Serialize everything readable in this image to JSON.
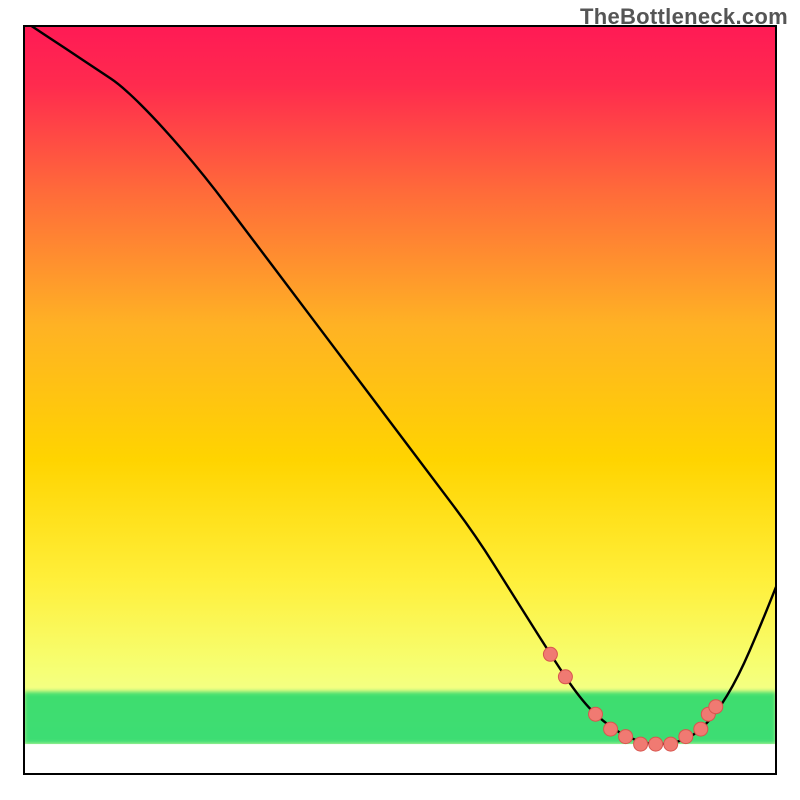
{
  "watermark": "TheBottleneck.com",
  "colors": {
    "curve": "#000000",
    "marker_fill": "#f07a72",
    "marker_stroke": "#d8564f",
    "frame": "#000000"
  },
  "chart_data": {
    "type": "line",
    "title": "",
    "xlabel": "",
    "ylabel": "",
    "xlim": [
      0,
      100
    ],
    "ylim": [
      0,
      100
    ],
    "grid": false,
    "legend": false,
    "note": "Axes are unlabeled percent scales inferred from the frame. Curve is read from pixel position; y=0 is the bottom of the inner plot, y=100 is the top.",
    "background_gradient": {
      "top_color": "#ff1a55",
      "mid_color": "#ffd400",
      "green_band_top": 11,
      "green_band_bottom": 4,
      "green_color": "#1fd86b",
      "bottom_color": "#ffffff"
    },
    "series": [
      {
        "name": "bottleneck-curve",
        "x": [
          1,
          4,
          7,
          10,
          13,
          18,
          24,
          30,
          36,
          42,
          48,
          54,
          60,
          65,
          70,
          74,
          77,
          80,
          83,
          86,
          89,
          92,
          95,
          98,
          100
        ],
        "y": [
          100,
          98,
          96,
          94,
          92,
          87,
          80,
          72,
          64,
          56,
          48,
          40,
          32,
          24,
          16,
          10,
          7,
          5,
          4,
          4,
          5,
          8,
          13,
          20,
          25
        ]
      }
    ],
    "markers": {
      "name": "highlight-points",
      "note": "Salmon circular markers clustered near the curve minimum.",
      "points": [
        {
          "x": 70,
          "y": 16
        },
        {
          "x": 72,
          "y": 13
        },
        {
          "x": 76,
          "y": 8
        },
        {
          "x": 78,
          "y": 6
        },
        {
          "x": 80,
          "y": 5
        },
        {
          "x": 82,
          "y": 4
        },
        {
          "x": 84,
          "y": 4
        },
        {
          "x": 86,
          "y": 4
        },
        {
          "x": 88,
          "y": 5
        },
        {
          "x": 90,
          "y": 6
        },
        {
          "x": 91,
          "y": 8
        },
        {
          "x": 92,
          "y": 9
        }
      ]
    }
  }
}
